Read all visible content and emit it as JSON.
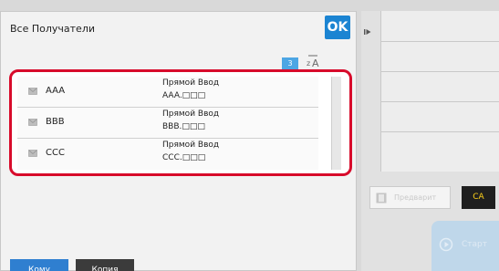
{
  "dialog": {
    "title": "Все Получатели",
    "ok_label": "OK",
    "count": "3"
  },
  "recipients": [
    {
      "name": "AAA",
      "type": "Прямой Ввод",
      "address": "AAA.□□□"
    },
    {
      "name": "BBB",
      "type": "Прямой Ввод",
      "address": "BBB.□□□"
    },
    {
      "name": "CCC",
      "type": "Прямой Ввод",
      "address": "CCC.□□□"
    }
  ],
  "tabs": {
    "to_label": "Кому",
    "cc_label": "Копия"
  },
  "side": {
    "preview_label": "Предварит",
    "ca_label": "CA",
    "start_label": "Старт"
  },
  "colors": {
    "accent": "#1b84d2",
    "highlight": "#d80b2b",
    "ca_text": "#ffd21a"
  }
}
